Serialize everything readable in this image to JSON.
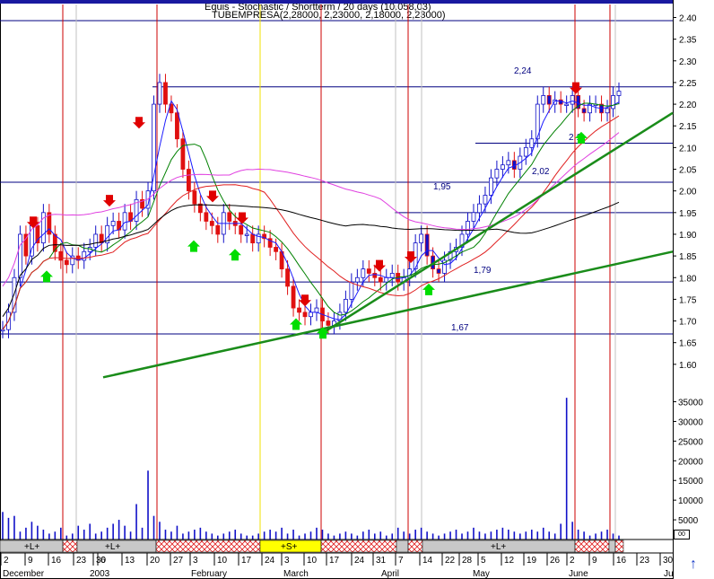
{
  "header": {
    "line1": "Equis - Stochastic / Shortterm / 20 days (10.058,03)",
    "line2": "TUBEMPRESA(2,28000, 2,23000, 2,18000, 2,23000)"
  },
  "colors": {
    "background": "#ffffff",
    "price_bar": "#1010c8",
    "price_bar_down": "#e01010",
    "ma_short": "#1a1aff",
    "ma_mid": "#008000",
    "ma_long": "#e02020",
    "ma_magenta": "#e040e0",
    "ma_black": "#000000",
    "trend_line": "#1a8c1a",
    "signal_line": "#cc0000",
    "signal_line_alt": "#f0e000",
    "volume": "#1010c8",
    "hatch": "#e02020",
    "buy_arrow": "#00dd00",
    "sell_arrow": "#e00000"
  },
  "chart_data": {
    "type": "candlestick",
    "price_axis": {
      "ylim": [
        1.55,
        2.43
      ],
      "ticks": [
        "2.40",
        "2.35",
        "2.30",
        "2.25",
        "2.20",
        "2.15",
        "2.10",
        "2.05",
        "2.00",
        "1.95",
        "1.90",
        "1.85",
        "1.80",
        "1.75",
        "1.70",
        "1.65",
        "1.60"
      ]
    },
    "volume_axis": {
      "ylim": [
        0,
        39000
      ],
      "ticks": [
        "35000",
        "30000",
        "25000",
        "20000",
        "15000",
        "10000",
        "5000"
      ]
    },
    "x_axis": {
      "ticks": [
        "2",
        "9",
        "16",
        "23",
        "30",
        "6",
        "13",
        "20",
        "27",
        "3",
        "10",
        "17",
        "24",
        "3",
        "10",
        "17",
        "24",
        "31",
        "7",
        "14",
        "22",
        "28",
        "5",
        "12",
        "19",
        "26",
        "2",
        "9",
        "16",
        "23",
        "30"
      ],
      "months": [
        "December",
        "2003",
        "February",
        "March",
        "April",
        "May",
        "June",
        "Ju"
      ]
    },
    "price_levels": [
      {
        "label": "2,24",
        "value": 2.24
      },
      {
        "label": "2,11",
        "value": 2.11
      },
      {
        "label": "2,02",
        "value": 2.02
      },
      {
        "label": "1,95",
        "value": 1.95
      },
      {
        "label": "1,79",
        "value": 1.79
      },
      {
        "label": "1,67",
        "value": 1.67
      }
    ],
    "signal_bands": [
      {
        "label": "+L+",
        "state": "long"
      },
      {
        "label": "+L+",
        "state": "long"
      },
      {
        "label": "+S+",
        "state": "short"
      },
      {
        "label": "+L+",
        "state": "long"
      }
    ],
    "close_series": [
      1.68,
      1.72,
      1.8,
      1.9,
      1.85,
      1.92,
      1.88,
      1.95,
      1.9,
      1.86,
      1.84,
      1.83,
      1.85,
      1.84,
      1.86,
      1.87,
      1.9,
      1.88,
      1.92,
      1.93,
      1.91,
      1.95,
      1.93,
      1.98,
      1.96,
      2.0,
      2.2,
      2.25,
      2.2,
      2.18,
      2.12,
      2.05,
      2.0,
      1.97,
      1.95,
      1.93,
      1.92,
      1.9,
      1.95,
      1.93,
      1.92,
      1.9,
      1.9,
      1.88,
      1.9,
      1.89,
      1.87,
      1.86,
      1.82,
      1.78,
      1.73,
      1.72,
      1.71,
      1.72,
      1.73,
      1.7,
      1.69,
      1.7,
      1.72,
      1.75,
      1.79,
      1.8,
      1.82,
      1.81,
      1.8,
      1.79,
      1.8,
      1.81,
      1.79,
      1.8,
      1.82,
      1.88,
      1.9,
      1.85,
      1.82,
      1.81,
      1.84,
      1.86,
      1.87,
      1.9,
      1.93,
      1.95,
      1.97,
      1.99,
      2.03,
      2.05,
      2.06,
      2.07,
      2.05,
      2.08,
      2.1,
      2.12,
      2.2,
      2.22,
      2.2,
      2.21,
      2.2,
      2.2,
      2.22,
      2.19,
      2.18,
      2.2,
      2.2,
      2.18,
      2.19,
      2.22,
      2.23
    ],
    "volume_series": [
      7000,
      5500,
      6000,
      2000,
      3000,
      4500,
      3500,
      2500,
      1500,
      2000,
      3000,
      1000,
      1500,
      3500,
      2500,
      4000,
      1500,
      2000,
      3000,
      4000,
      5000,
      3500,
      2000,
      9000,
      3000,
      17500,
      6000,
      4500,
      2500,
      2000,
      3500,
      1500,
      2000,
      2500,
      3000,
      2000,
      1500,
      1000,
      1500,
      2000,
      2500,
      1500,
      1000,
      1000,
      1500,
      2000,
      2500,
      2000,
      3000,
      1500,
      2500,
      1000,
      1500,
      2000,
      3000,
      2500,
      1500,
      1000,
      1500,
      2000,
      1500,
      1000,
      2000,
      2500,
      1500,
      2000,
      1000,
      1500,
      3000,
      2000,
      1500,
      2500,
      3000,
      2000,
      1500,
      1000,
      1500,
      2000,
      2500,
      1500,
      2000,
      3000,
      2000,
      1500,
      2000,
      2500,
      3000,
      2500,
      2000,
      1500,
      2000,
      2500,
      2000,
      3000,
      2000,
      1500,
      4000,
      36000,
      4500,
      2500,
      2000,
      1000,
      1500,
      2000,
      2500,
      1500,
      1000
    ]
  }
}
